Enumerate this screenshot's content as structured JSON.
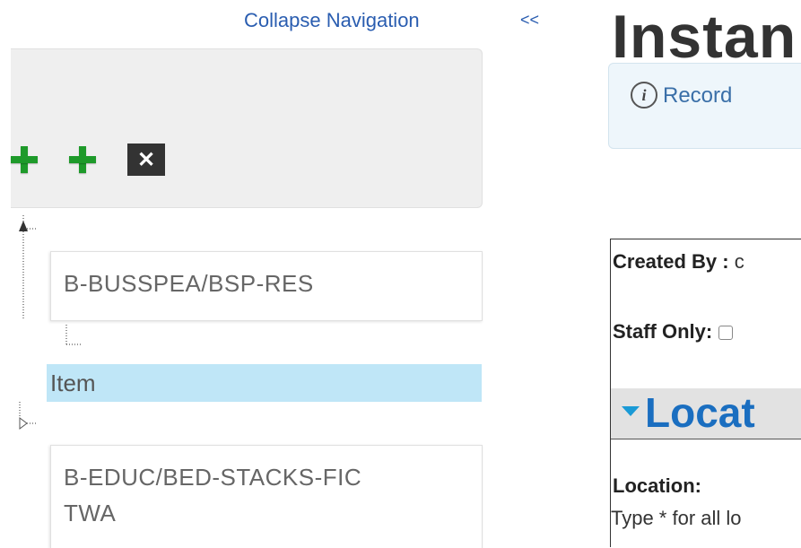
{
  "sidebar": {
    "collapse_label": "Collapse Navigation",
    "collapse_arrows": "<<",
    "toolbar": {
      "add_icon": "plus-icon",
      "remove_icon": "close-icon",
      "remove_symbol": "✕"
    },
    "tree": {
      "nodes": [
        {
          "label": "B-BUSSPEA/BSP-RES"
        },
        {
          "label_line1": "B-EDUC/BED-STACKS-FIC",
          "label_line2": "TWA"
        }
      ],
      "selected_item": "Item"
    }
  },
  "main": {
    "title": "Instan",
    "info_icon": "i",
    "info_text": "Record",
    "form": {
      "created_by_label": "Created By :",
      "created_by_value": "c",
      "staff_only_label": "Staff Only:",
      "section_title": "Locat",
      "location_label": "Location:",
      "location_hint": "Type * for all lo"
    }
  },
  "colors": {
    "link": "#2a5db0",
    "selected": "#bfe6f7",
    "section_title": "#1a6ec0",
    "plus": "#1e9a2a"
  }
}
